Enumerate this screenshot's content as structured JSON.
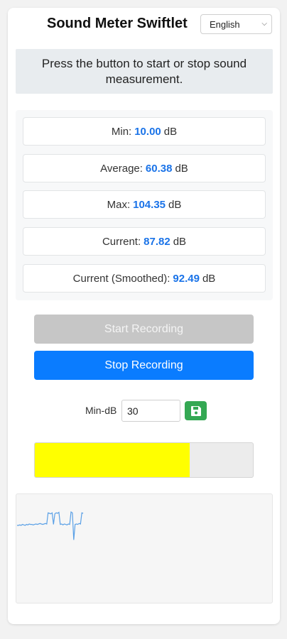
{
  "app": {
    "title": "Sound Meter Swiftlet"
  },
  "language": {
    "selected": "English",
    "icon": "chevron-down-icon"
  },
  "banner": {
    "text": "Press the button to start or stop sound measurement."
  },
  "stats": [
    {
      "label": "Min:",
      "value": "10.00",
      "unit": "dB"
    },
    {
      "label": "Average:",
      "value": "60.38",
      "unit": "dB"
    },
    {
      "label": "Max:",
      "value": "104.35",
      "unit": "dB"
    },
    {
      "label": "Current:",
      "value": "87.82",
      "unit": "dB"
    },
    {
      "label": "Current (Smoothed):",
      "value": "92.49",
      "unit": "dB"
    }
  ],
  "buttons": {
    "start_label": "Start Recording",
    "stop_label": "Stop Recording"
  },
  "min_db": {
    "label": "Min-dB",
    "value": "30",
    "save_icon": "save-icon"
  },
  "level_meter": {
    "fill_fraction": 0.71,
    "color": "#ffff00"
  },
  "history_graph": {
    "line_color": "#5aa0e6",
    "values": [
      60,
      60,
      61,
      60,
      62,
      61,
      60,
      62,
      61,
      63,
      62,
      62,
      61,
      62,
      63,
      62,
      63,
      64,
      63,
      62,
      63,
      64,
      63,
      86,
      85,
      84,
      86,
      62,
      84,
      86,
      85,
      87,
      62,
      63,
      61,
      63,
      62,
      61,
      63,
      62,
      88,
      86,
      30,
      62,
      63,
      62,
      64,
      63,
      86,
      85
    ]
  }
}
